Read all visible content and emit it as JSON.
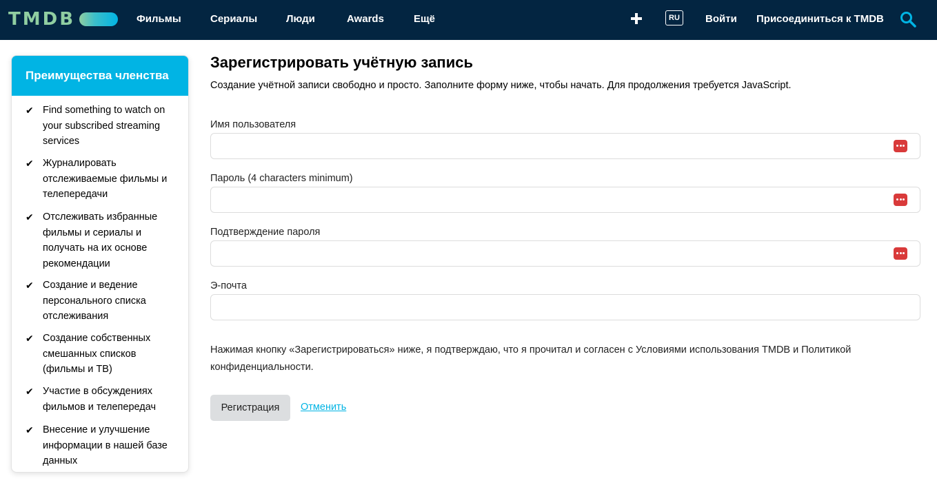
{
  "header": {
    "logo_text": "TMDB",
    "nav": [
      "Фильмы",
      "Сериалы",
      "Люди",
      "Awards",
      "Ещё"
    ],
    "lang": "RU",
    "login": "Войти",
    "join": "Присоединиться к TMDB",
    "icons": {
      "add": "plus-icon",
      "search": "search-icon"
    },
    "colors": {
      "bar": "#032541",
      "accent": "#01b4e4",
      "logo": "#90cea1"
    }
  },
  "sidebar": {
    "title": "Преимущества членства",
    "items": [
      "Find something to watch on your subscribed streaming services",
      "Журналировать отслеживаемые фильмы и телепередачи",
      "Отслеживать избранные фильмы и сериалы и получать на их основе рекомендации",
      "Создание и ведение персонального списка отслеживания",
      "Создание собственных смешанных списков (фильмы и ТВ)",
      "Участие в обсуждениях фильмов и телепередач",
      "Внесение и улучшение информации в нашей базе данных"
    ]
  },
  "form": {
    "title": "Зарегистрировать учётную запись",
    "subtitle": "Создание учётной записи свободно и просто. Заполните форму ниже, чтобы начать. Для продолжения требуется JavaScript.",
    "username_label": "Имя пользователя",
    "username_value": "",
    "password_label": "Пароль (4 characters minimum)",
    "password_value": "",
    "confirm_label": "Подтверждение пароля",
    "confirm_value": "",
    "email_label": "Э-почта",
    "email_value": "",
    "terms": "Нажимая кнопку «Зарегистрироваться» ниже, я подтверждаю, что я прочитал и согласен с Условиями использования TMDB и Политикой конфиденциальности.",
    "register_label": "Регистрация",
    "cancel_label": "Отменить"
  }
}
